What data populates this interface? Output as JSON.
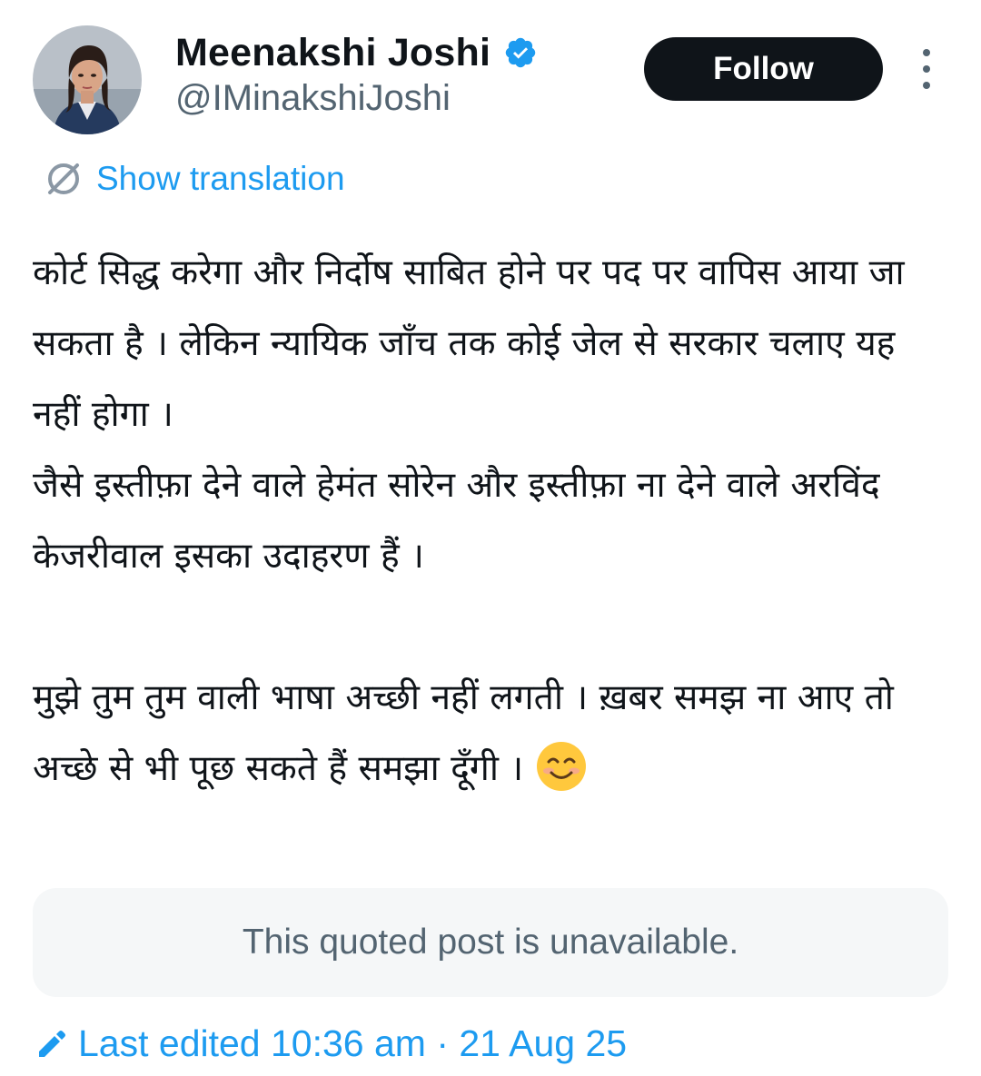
{
  "author": {
    "display_name": "Meenakshi Joshi",
    "handle": "@IMinakshiJoshi",
    "verified": true,
    "verified_color": "#1d9bf0",
    "avatar_icon": "profile-photo"
  },
  "actions": {
    "follow_label": "Follow",
    "more_icon": "more-vertical-icon"
  },
  "translation": {
    "label": "Show translation",
    "icon": "globe-translate-icon"
  },
  "post": {
    "paragraphs": [
      "कोर्ट सिद्ध करेगा और निर्दोष साबित होने पर पद पर वापिस आया जा सकता है । लेकिन न्यायिक जाँच तक कोई जेल से सरकार चलाए यह नहीं होगा ।\nजैसे इस्तीफ़ा देने वाले हेमंत सोरेन और इस्तीफ़ा ना देने वाले अरविंद केजरीवाल इसका उदाहरण हैं ।",
      "मुझे तुम तुम वाली भाषा अच्छी नहीं लगती । ख़बर समझ ना आए तो अच्छे से भी पूछ सकते हैं समझा दूँगी । "
    ],
    "emoji": "smiling-face-emoji"
  },
  "quote": {
    "text": "This quoted post is unavailable."
  },
  "edited": {
    "text": "Last edited 10:36 am · 21 Aug 25",
    "icon": "pencil-edit-icon"
  },
  "colors": {
    "accent": "#1d9bf0",
    "text_primary": "#0f1419",
    "text_secondary": "#536471",
    "follow_bg": "#0f1419",
    "quote_bg": "#f5f7f8"
  }
}
